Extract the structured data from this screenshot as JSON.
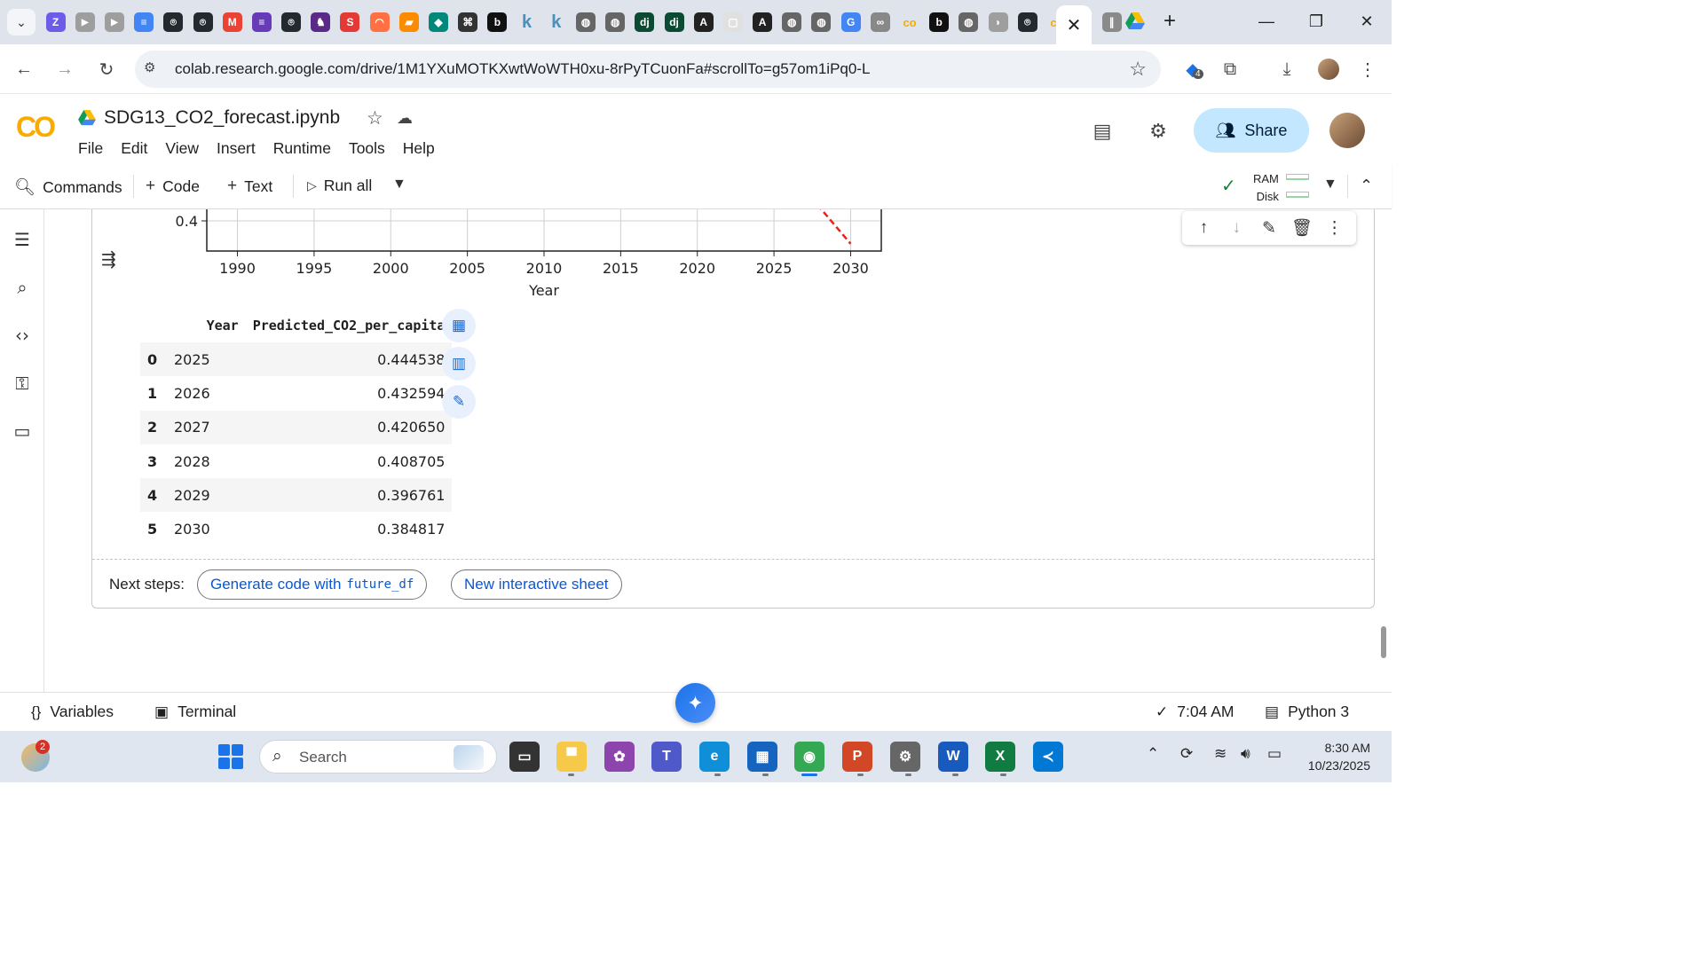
{
  "browser": {
    "pinned_tab_icons": [
      "zulip-icon",
      "youtube-icon",
      "youtube-icon",
      "docs-icon",
      "github-icon",
      "github-icon",
      "gmail-icon",
      "forms-icon",
      "github-icon",
      "ext-icon",
      "scribd-icon",
      "orange-arc-icon",
      "orange-doc-icon",
      "diamond-icon",
      "openai-icon",
      "bold-b-icon",
      "k-icon",
      "k-icon",
      "globe-icon",
      "globe-icon",
      "dj-icon",
      "dj-icon",
      "a-icon",
      "box-icon",
      "a-icon",
      "globe-icon",
      "globe-icon",
      "google-icon",
      "link-icon",
      "colab-icon",
      "bold-b-icon",
      "globe-icon",
      "grey-icon",
      "github-icon",
      "colab-icon"
    ],
    "active_tab_close": "✕",
    "after_tabs_icons": [
      "ii-icon",
      "drive-icon"
    ],
    "new_tab": "+",
    "minimize": "—",
    "restore": "❐",
    "close": "✕",
    "url": "colab.research.google.com/drive/1M1YXuMOTKXwtWoWTH0xu-8rPyTCuonFa#scrollTo=g57om1iPq0-L",
    "extension_badge": "4"
  },
  "colab": {
    "logo": "CO",
    "title": "SDG13_CO2_forecast.ipynb",
    "menu": [
      "File",
      "Edit",
      "View",
      "Insert",
      "Runtime",
      "Tools",
      "Help"
    ],
    "share_label": "Share",
    "toolbar": {
      "commands": "Commands",
      "code": "Code",
      "text": "Text",
      "run_all": "Run all"
    },
    "resources": {
      "ram": "RAM",
      "disk": "Disk"
    }
  },
  "chart_data": {
    "type": "line",
    "xlabel": "Year",
    "ylabel": "",
    "xlim": [
      1988,
      2032
    ],
    "x_ticks": [
      1990,
      1995,
      2000,
      2005,
      2010,
      2015,
      2020,
      2025,
      2030
    ],
    "y_ticks_visible": [
      0.4
    ],
    "series": [
      {
        "style": "dashed",
        "color": "#e8221b",
        "x": [
          2027,
          2028,
          2029,
          2030
        ],
        "y": [
          0.42065,
          0.408705,
          0.396761,
          0.384817
        ]
      }
    ]
  },
  "dataframe": {
    "columns": [
      "",
      "Year",
      "Predicted_CO2_per_capita"
    ],
    "rows": [
      {
        "index": "0",
        "year": "2025",
        "value": "0.444538"
      },
      {
        "index": "1",
        "year": "2026",
        "value": "0.432594"
      },
      {
        "index": "2",
        "year": "2027",
        "value": "0.420650"
      },
      {
        "index": "3",
        "year": "2028",
        "value": "0.408705"
      },
      {
        "index": "4",
        "year": "2029",
        "value": "0.396761"
      },
      {
        "index": "5",
        "year": "2030",
        "value": "0.384817"
      }
    ]
  },
  "next_steps": {
    "label": "Next steps:",
    "generate_prefix": "Generate code with",
    "generate_var": "future_df",
    "interactive": "New interactive sheet"
  },
  "statusbar": {
    "variables": "Variables",
    "terminal": "Terminal",
    "time": "7:04 AM",
    "kernel": "Python 3"
  },
  "taskbar": {
    "notification_count": "2",
    "search_placeholder": "Search",
    "time": "8:30 AM",
    "date": "10/23/2025"
  },
  "colors": {
    "accent": "#0b57d0",
    "share_bg": "#c2e7ff",
    "colab_orange": "#f9ab00"
  }
}
